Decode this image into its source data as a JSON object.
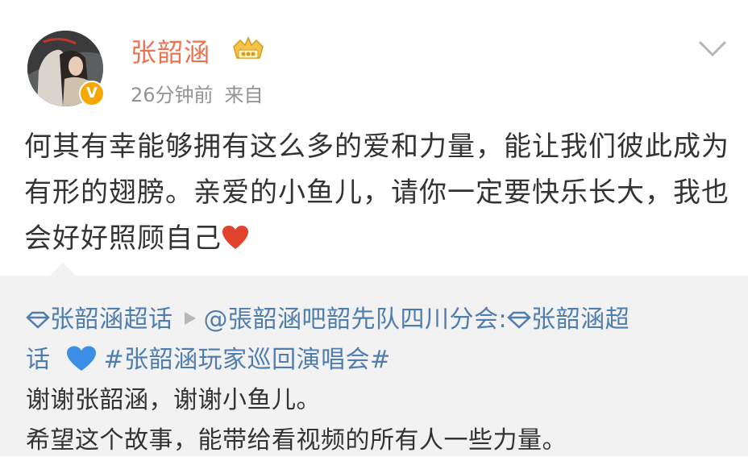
{
  "header": {
    "username": "张韶涵",
    "time": "26分钟前",
    "source": "来自",
    "icons": {
      "avatar": "avatar-photo",
      "verified": "verified-v-icon",
      "vip": "vip-crown-icon",
      "more": "chevron-down-icon"
    }
  },
  "post": {
    "text": "何其有幸能够拥有这么多的爱和力量，能让我们彼此成为有形的翅膀。亲爱的小鱼儿，请你一定要快乐长大，我也会好好照顾自己",
    "emoji": "red-heart-icon"
  },
  "repost": {
    "topic1": "张韶涵超话",
    "mention": "@張韶涵吧韶先队四川分会:",
    "topic2_part1": "张韶涵超",
    "topic2_part2": "话",
    "hashtag": "#张韶涵玩家巡回演唱会#",
    "line2": "谢谢张韶涵，谢谢小鱼儿。",
    "line3": "希望这个故事，能带给看视频的所有人一些力量。",
    "colors": {
      "link": "#507daf",
      "background": "#f2f2f2"
    }
  },
  "colors": {
    "username": "#eb7350",
    "meta": "#939393",
    "text": "#333333"
  }
}
